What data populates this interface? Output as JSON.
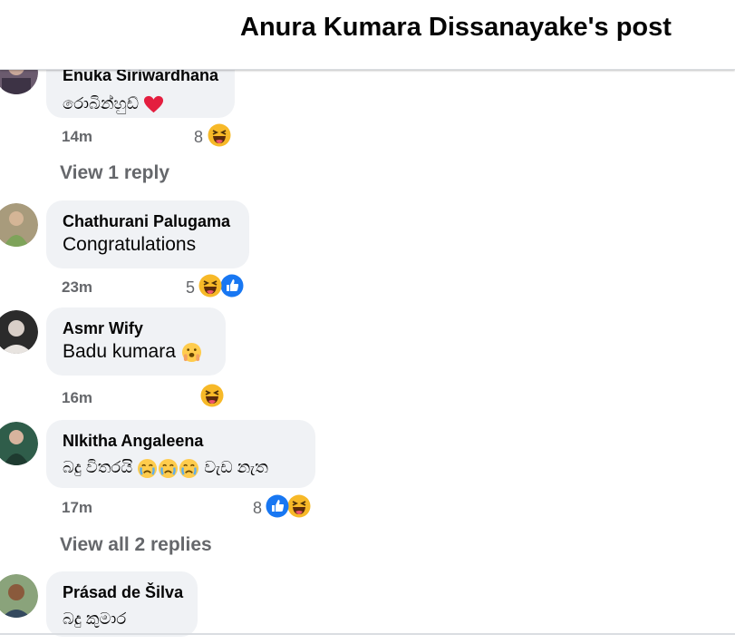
{
  "header": {
    "title": "Anura Kumara Dissanayake's post"
  },
  "comments": [
    {
      "author": "Enuka Siriwardhana",
      "text": "රොබින්හුඩ්",
      "time": "14m",
      "reactions": "8",
      "replies": "View 1 reply"
    },
    {
      "author": "Chathurani Palugama",
      "text": "Congratulations",
      "time": "23m",
      "reactions": "5"
    },
    {
      "author": "Asmr Wify",
      "text": "Badu kumara",
      "time": "16m",
      "reactions": ""
    },
    {
      "author": "NIkitha Angaleena",
      "text_a": "බදු විතරයි",
      "text_b": "වැඩ නැත",
      "time": "17m",
      "reactions": "8",
      "replies": "View all 2 replies"
    },
    {
      "author": "Prásad de Šilva",
      "text": "බදු කුමාර"
    }
  ],
  "colors": {
    "bubble": "#f0f2f5",
    "meta": "#65676b",
    "like_blue": "#1877f2",
    "heart": "#e41e3f",
    "haha_yellow": "#f7b928"
  },
  "icons": [
    "heart-icon",
    "haha-icon",
    "like-icon",
    "shy-face-icon",
    "crying-face-icon"
  ]
}
